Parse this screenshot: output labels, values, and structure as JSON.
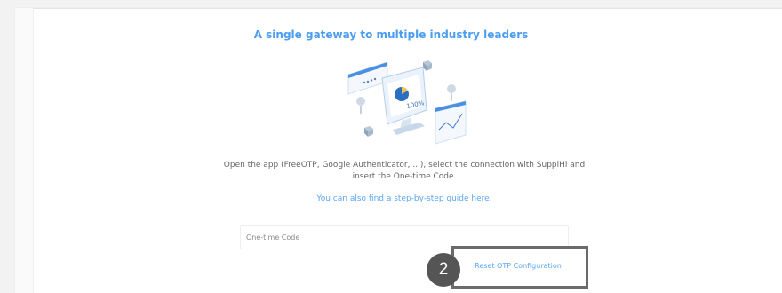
{
  "header": {
    "headline": "A single gateway to multiple industry leaders"
  },
  "illustration": {
    "icon": "dashboard-illustration-icon",
    "percent_label": "100%"
  },
  "instructions": {
    "line": "Open the app (FreeOTP, Google Authenticator, ...), select the connection with SupplHi and insert the One-time Code.",
    "guide_link": "You can also find a step-by-step guide here."
  },
  "form": {
    "otp_placeholder": "One-time Code",
    "otp_value": "",
    "reset_label": "Reset OTP Configuration"
  },
  "annotation": {
    "step_number": "2"
  },
  "colors": {
    "accent": "#4a9df2",
    "link": "#5aa6f5",
    "highlight": "#6a6a6a",
    "badge": "#555555"
  }
}
